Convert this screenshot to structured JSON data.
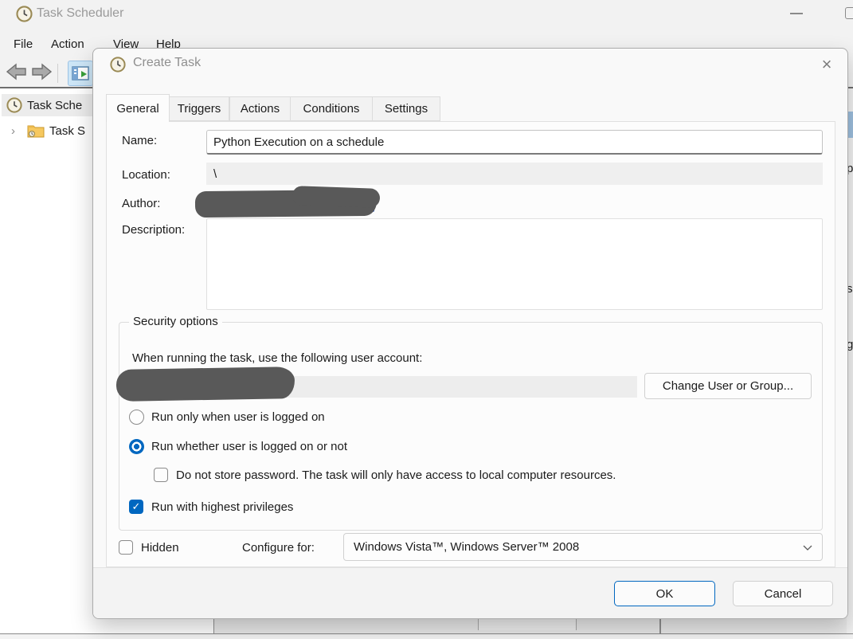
{
  "window": {
    "title": "Task Scheduler",
    "menu": {
      "items": [
        {
          "label": "File"
        },
        {
          "label": "Action"
        },
        {
          "label": "View"
        },
        {
          "label": "Help"
        }
      ]
    },
    "sidebar": {
      "items": [
        {
          "label": "Task Sche"
        },
        {
          "label": "Task S"
        }
      ]
    },
    "background_fragments": {
      "right_letters": [
        "p",
        "s",
        "g"
      ]
    }
  },
  "icons": {
    "close": "×",
    "check": "✓",
    "expander": "›",
    "dropdown_chevron": "chevron-down"
  },
  "dialog": {
    "title": "Create Task",
    "tabs": [
      {
        "label": "General",
        "active": true
      },
      {
        "label": "Triggers",
        "active": false
      },
      {
        "label": "Actions",
        "active": false
      },
      {
        "label": "Conditions",
        "active": false
      },
      {
        "label": "Settings",
        "active": false
      }
    ],
    "fields": {
      "name_label": "Name:",
      "name_value": "Python Execution on a schedule",
      "location_label": "Location:",
      "location_value": "\\",
      "author_label": "Author:",
      "author_value_redacted": true,
      "description_label": "Description:",
      "description_value": ""
    },
    "security": {
      "legend": "Security options",
      "account_hint": "When running the task, use the following user account:",
      "account_value_redacted": true,
      "change_user_button": "Change User or Group...",
      "radio_logged_on": {
        "label": "Run only when user is logged on",
        "selected": false
      },
      "radio_logged_on_or_not": {
        "label": "Run whether user is logged on or not",
        "selected": true
      },
      "checkbox_no_password": {
        "label": "Do not store password.  The task will only have access to local computer resources.",
        "checked": false
      },
      "checkbox_highest_privileges": {
        "label": "Run with highest privileges",
        "checked": true
      }
    },
    "footer_row": {
      "hidden_checkbox": {
        "label": "Hidden",
        "checked": false
      },
      "configure_label": "Configure for:",
      "configure_value": "Windows Vista™, Windows Server™ 2008"
    },
    "buttons": {
      "ok": "OK",
      "cancel": "Cancel"
    }
  },
  "colors": {
    "accent": "#0067C0",
    "redaction": "#595959",
    "selection_blue": "#9dbfde"
  }
}
